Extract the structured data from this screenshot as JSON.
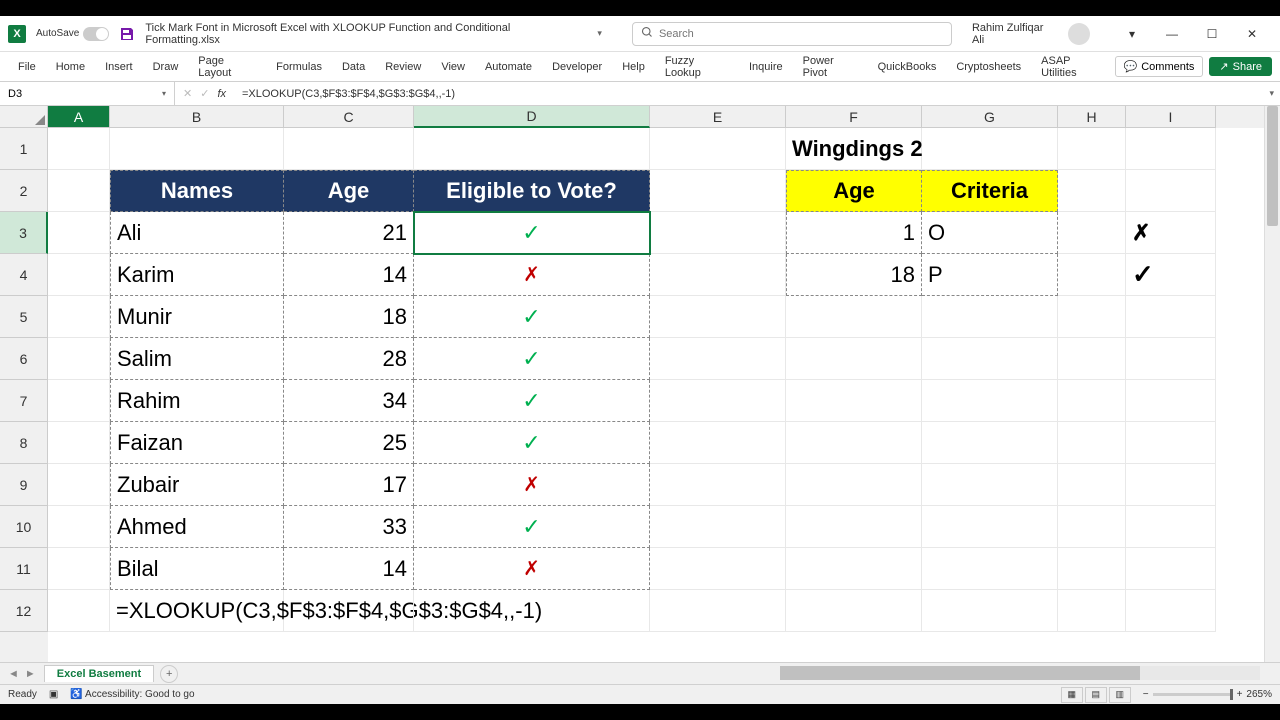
{
  "titlebar": {
    "autosave": "AutoSave",
    "doc_title": "Tick Mark Font in Microsoft Excel with XLOOKUP Function and Conditional Formatting.xlsx",
    "search_placeholder": "Search",
    "user": "Rahim Zulfiqar Ali"
  },
  "ribbon": {
    "tabs": [
      "File",
      "Home",
      "Insert",
      "Draw",
      "Page Layout",
      "Formulas",
      "Data",
      "Review",
      "View",
      "Automate",
      "Developer",
      "Help",
      "Fuzzy Lookup",
      "Inquire",
      "Power Pivot",
      "QuickBooks",
      "Cryptosheets",
      "ASAP Utilities"
    ],
    "comments": "Comments",
    "share": "Share"
  },
  "formula_bar": {
    "name_box": "D3",
    "formula": "=XLOOKUP(C3,$F$3:$F$4,$G$3:$G$4,,-1)"
  },
  "columns": [
    "A",
    "B",
    "C",
    "D",
    "E",
    "F",
    "G",
    "H",
    "I"
  ],
  "rows": [
    "1",
    "2",
    "3",
    "4",
    "5",
    "6",
    "7",
    "8",
    "9",
    "10",
    "11",
    "12"
  ],
  "sheet": {
    "f1": "Wingdings 2",
    "headers_main": {
      "b": "Names",
      "c": "Age",
      "d": "Eligible to Vote?"
    },
    "headers_side": {
      "f": "Age",
      "g": "Criteria"
    },
    "data": [
      {
        "name": "Ali",
        "age": "21",
        "eligible": "tick"
      },
      {
        "name": "Karim",
        "age": "14",
        "eligible": "cross"
      },
      {
        "name": "Munir",
        "age": "18",
        "eligible": "tick"
      },
      {
        "name": "Salim",
        "age": "28",
        "eligible": "tick"
      },
      {
        "name": "Rahim",
        "age": "34",
        "eligible": "tick"
      },
      {
        "name": "Faizan",
        "age": "25",
        "eligible": "tick"
      },
      {
        "name": "Zubair",
        "age": "17",
        "eligible": "cross"
      },
      {
        "name": "Ahmed",
        "age": "33",
        "eligible": "tick"
      },
      {
        "name": "Bilal",
        "age": "14",
        "eligible": "cross"
      }
    ],
    "criteria": [
      {
        "age": "1",
        "char": "O",
        "icon": "cross-black"
      },
      {
        "age": "18",
        "char": "P",
        "icon": "tick-black"
      }
    ],
    "formula_display": "=XLOOKUP(C3,$F$3:$F$4,$G$3:$G$4,,-1)"
  },
  "sheet_tab": "Excel Basement",
  "status": {
    "ready": "Ready",
    "access": "Accessibility: Good to go",
    "zoom": "265%"
  }
}
